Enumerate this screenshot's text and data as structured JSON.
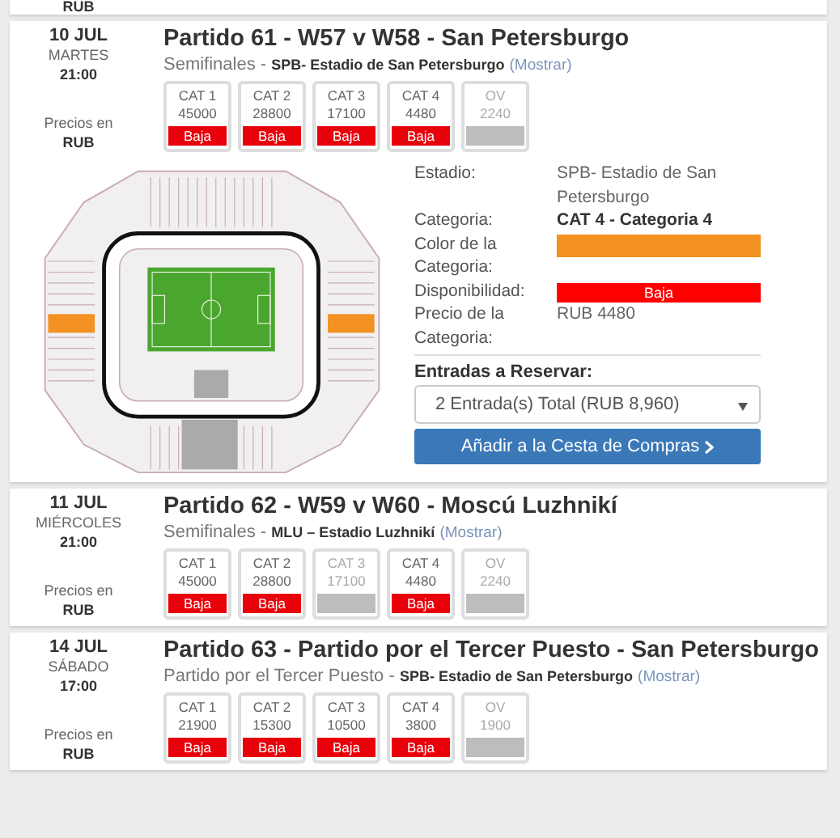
{
  "previous_card": {
    "currency": "RUB"
  },
  "matches": [
    {
      "date": "10 JUL",
      "weekday": "MARTES",
      "time": "21:00",
      "prices_label": "Precios en",
      "currency": "RUB",
      "title": "Partido 61 - W57 v W58 - San Petersburgo",
      "stage": "Semifinales",
      "separator": "-",
      "venue": "SPB- Estadio de San Petersburgo",
      "link": "(Mostrar)",
      "categories": [
        {
          "label": "CAT 1",
          "price": "45000",
          "available": true,
          "availability": "Baja"
        },
        {
          "label": "CAT 2",
          "price": "28800",
          "available": true,
          "availability": "Baja"
        },
        {
          "label": "CAT 3",
          "price": "17100",
          "available": true,
          "availability": "Baja"
        },
        {
          "label": "CAT 4",
          "price": "4480",
          "available": true,
          "availability": "Baja"
        },
        {
          "label": "OV",
          "price": "2240",
          "available": false
        }
      ],
      "details": {
        "rows": [
          {
            "kind": "text",
            "label": "Estadio:",
            "value": "SPB- Estadio de San Petersburgo"
          },
          {
            "kind": "bold",
            "label": "Categoria:",
            "value": "CAT 4 - Categoria 4"
          },
          {
            "kind": "color",
            "label": "Color de la Categoria:",
            "color": "#f39122"
          },
          {
            "kind": "availability",
            "label": "Disponibilidad:",
            "value": "Baja"
          },
          {
            "kind": "text",
            "label": "Precio de la Categoria:",
            "value": "RUB 4480"
          }
        ],
        "tickets_label": "Entradas a Reservar:",
        "tickets_value": "2 Entrada(s) Total (RUB 8,960)",
        "button": "Añadir a la Cesta de Compras"
      }
    },
    {
      "date": "11 JUL",
      "weekday": "MIÉRCOLES",
      "time": "21:00",
      "prices_label": "Precios en",
      "currency": "RUB",
      "title": "Partido 62 - W59 v W60 - Moscú Luzhnikí",
      "stage": "Semifinales",
      "separator": "-",
      "venue": "MLU – Estadio Luzhnikí",
      "link": "(Mostrar)",
      "categories": [
        {
          "label": "CAT 1",
          "price": "45000",
          "available": true,
          "availability": "Baja"
        },
        {
          "label": "CAT 2",
          "price": "28800",
          "available": true,
          "availability": "Baja"
        },
        {
          "label": "CAT 3",
          "price": "17100",
          "available": false
        },
        {
          "label": "CAT 4",
          "price": "4480",
          "available": true,
          "availability": "Baja"
        },
        {
          "label": "OV",
          "price": "2240",
          "available": false
        }
      ]
    },
    {
      "date": "14 JUL",
      "weekday": "SÁBADO",
      "time": "17:00",
      "prices_label": "Precios en",
      "currency": "RUB",
      "title": "Partido 63 - Partido por el Tercer Puesto - San Petersburgo",
      "stage": "Partido por el Tercer Puesto",
      "separator": "-",
      "venue": "SPB- Estadio de San Petersburgo",
      "link": "(Mostrar)",
      "categories": [
        {
          "label": "CAT 1",
          "price": "21900",
          "available": true,
          "availability": "Baja"
        },
        {
          "label": "CAT 2",
          "price": "15300",
          "available": true,
          "availability": "Baja"
        },
        {
          "label": "CAT 3",
          "price": "10500",
          "available": true,
          "availability": "Baja"
        },
        {
          "label": "CAT 4",
          "price": "3800",
          "available": true,
          "availability": "Baja"
        },
        {
          "label": "OV",
          "price": "1900",
          "available": false
        }
      ]
    }
  ]
}
